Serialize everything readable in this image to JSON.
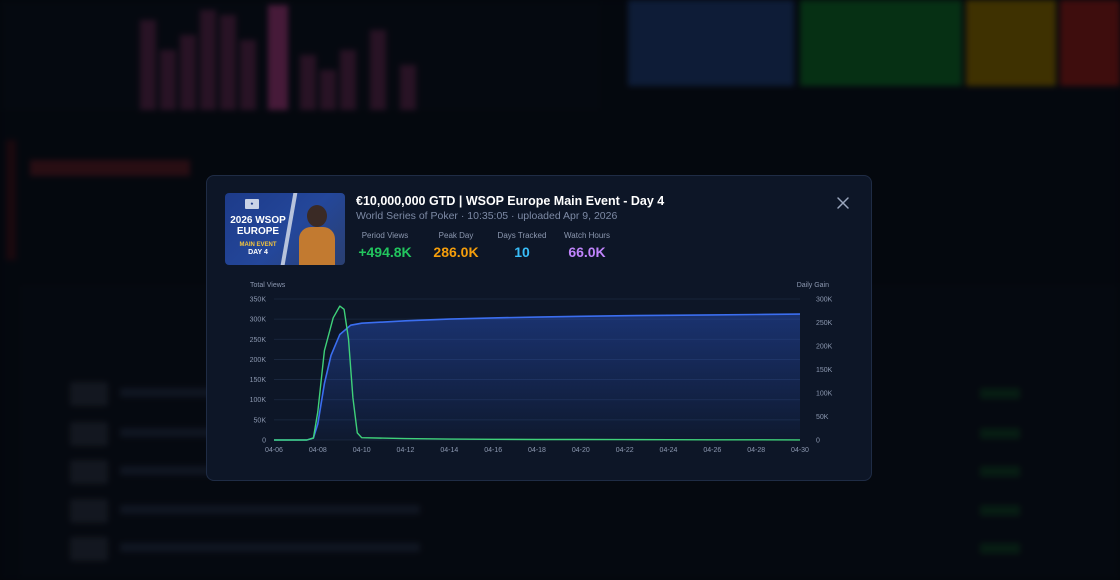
{
  "colors": {
    "modal_bg": "#0d1627",
    "views_positive": "#22c55e",
    "peak": "#f59e0b",
    "days": "#38bdf8",
    "watch": "#c084fc",
    "total_line": "#3b6ef0",
    "gain_line": "#3fd17a"
  },
  "icons": {
    "close": "close-icon"
  },
  "thumbnail": {
    "line1": "2026 WSOP",
    "line2": "EUROPE",
    "line3": "MAIN EVENT",
    "line4": "DAY 4"
  },
  "video": {
    "title": "€10,000,000 GTD | WSOP Europe Main Event - Day 4",
    "meta": "World Series of Poker · 10:35:05 · uploaded Apr 9, 2026"
  },
  "stats": [
    {
      "label": "Period Views",
      "value": "+494.8K"
    },
    {
      "label": "Peak Day",
      "value": "286.0K"
    },
    {
      "label": "Days Tracked",
      "value": "10"
    },
    {
      "label": "Watch Hours",
      "value": "66.0K"
    }
  ],
  "chart_data": {
    "type": "line",
    "left_axis_label": "Total Views",
    "right_axis_label": "Daily Gain",
    "x_ticks": [
      "04-06",
      "04-08",
      "04-10",
      "04-12",
      "04-14",
      "04-16",
      "04-18",
      "04-20",
      "04-22",
      "04-24",
      "04-26",
      "04-28",
      "04-30"
    ],
    "y_left_ticks": [
      "0",
      "50K",
      "100K",
      "150K",
      "200K",
      "250K",
      "300K",
      "350K"
    ],
    "y_right_ticks": [
      "0",
      "50K",
      "100K",
      "150K",
      "200K",
      "250K",
      "300K"
    ],
    "y_left_range": [
      0,
      350000
    ],
    "y_right_range": [
      0,
      300000
    ],
    "x_range_days": [
      6,
      30
    ],
    "series": [
      {
        "name": "Total Views",
        "axis": "left",
        "x": [
          6,
          7,
          7.5,
          7.8,
          8.0,
          8.3,
          8.6,
          9.0,
          9.5,
          10,
          12,
          14,
          16,
          18,
          20,
          22,
          24,
          26,
          28,
          30
        ],
        "y": [
          0,
          0,
          0,
          5000,
          40000,
          140000,
          210000,
          262000,
          285000,
          290000,
          296000,
          300000,
          303000,
          305000,
          307000,
          308500,
          309500,
          310500,
          311500,
          312500
        ]
      },
      {
        "name": "Daily Gain",
        "axis": "right",
        "x": [
          6,
          7,
          7.5,
          7.8,
          8.0,
          8.3,
          8.7,
          9.0,
          9.2,
          9.4,
          9.6,
          9.8,
          10,
          12,
          14,
          16,
          18,
          20,
          22,
          24,
          26,
          28,
          30
        ],
        "y": [
          0,
          0,
          0,
          4000,
          60000,
          190000,
          260000,
          285000,
          278000,
          215000,
          90000,
          15000,
          5000,
          3000,
          2000,
          1500,
          1000,
          1000,
          800,
          600,
          500,
          400,
          300
        ]
      }
    ]
  }
}
